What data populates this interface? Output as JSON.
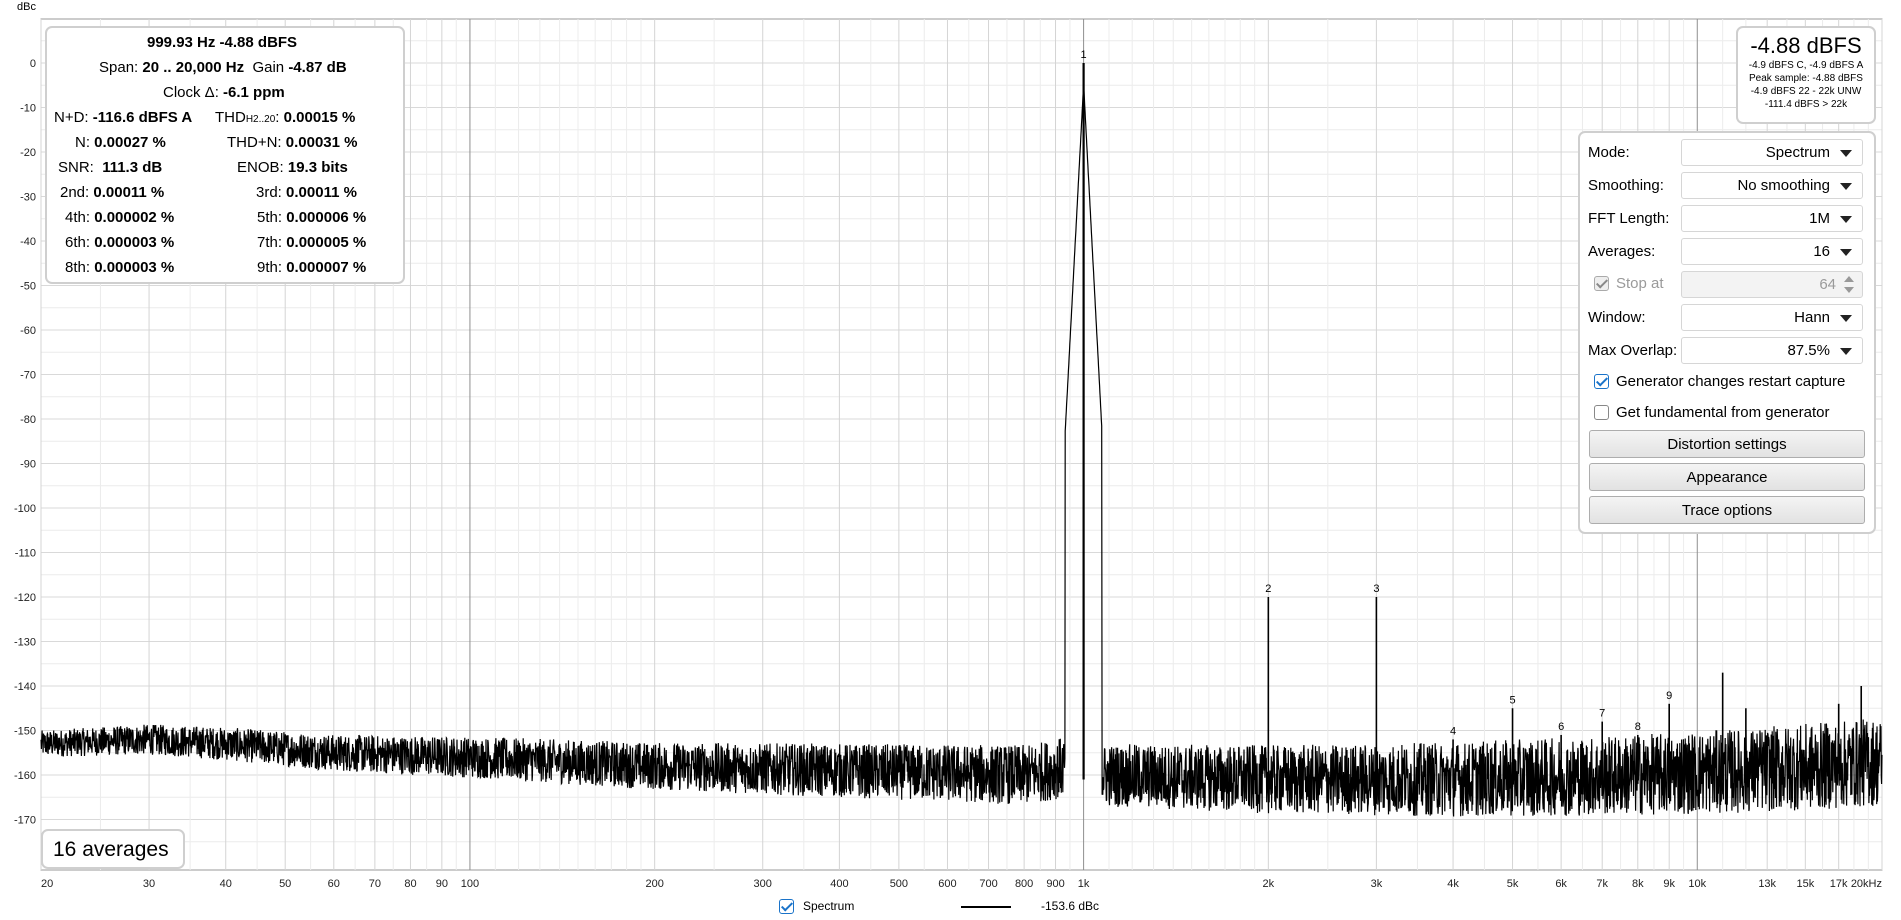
{
  "chart_data": {
    "type": "line",
    "title": "",
    "ylabel": "dBc",
    "xlabel": "",
    "x_scale": "log",
    "xlim": [
      20,
      20000
    ],
    "ylim": [
      -180,
      10
    ],
    "grid": true,
    "yticks": [
      0,
      -10,
      -20,
      -30,
      -40,
      -50,
      -60,
      -70,
      -80,
      -90,
      -100,
      -110,
      -120,
      -130,
      -140,
      -150,
      -160,
      -170
    ],
    "xtick_labels": [
      {
        "x": 20,
        "label": "20"
      },
      {
        "x": 30,
        "label": "30"
      },
      {
        "x": 40,
        "label": "40"
      },
      {
        "x": 50,
        "label": "50"
      },
      {
        "x": 60,
        "label": "60"
      },
      {
        "x": 70,
        "label": "70"
      },
      {
        "x": 80,
        "label": "80"
      },
      {
        "x": 90,
        "label": "90"
      },
      {
        "x": 100,
        "label": "100"
      },
      {
        "x": 200,
        "label": "200"
      },
      {
        "x": 300,
        "label": "300"
      },
      {
        "x": 400,
        "label": "400"
      },
      {
        "x": 500,
        "label": "500"
      },
      {
        "x": 600,
        "label": "600"
      },
      {
        "x": 700,
        "label": "700"
      },
      {
        "x": 800,
        "label": "800"
      },
      {
        "x": 900,
        "label": "900"
      },
      {
        "x": 1000,
        "label": "1k"
      },
      {
        "x": 2000,
        "label": "2k"
      },
      {
        "x": 3000,
        "label": "3k"
      },
      {
        "x": 4000,
        "label": "4k"
      },
      {
        "x": 5000,
        "label": "5k"
      },
      {
        "x": 6000,
        "label": "6k"
      },
      {
        "x": 7000,
        "label": "7k"
      },
      {
        "x": 8000,
        "label": "8k"
      },
      {
        "x": 9000,
        "label": "9k"
      },
      {
        "x": 10000,
        "label": "10k"
      },
      {
        "x": 13000,
        "label": "13k"
      },
      {
        "x": 15000,
        "label": "15k"
      },
      {
        "x": 17000,
        "label": "17k"
      },
      {
        "x": 20000,
        "label": "20kHz"
      }
    ],
    "minor_x_gridlines": [
      25,
      35,
      45,
      55,
      65,
      75,
      85,
      95,
      110,
      120,
      130,
      140,
      150,
      160,
      170,
      180,
      190,
      250,
      350,
      450,
      550,
      650,
      750,
      850,
      950,
      1100,
      1200,
      1300,
      1400,
      1500,
      1600,
      1700,
      1800,
      1900,
      2500,
      3500,
      4500,
      5500,
      6500,
      7500,
      8500,
      9500,
      11000,
      12000,
      14000,
      16000,
      18000,
      19000
    ],
    "major_x_gridlines": [
      100,
      1000,
      10000
    ],
    "noise_floor": [
      [
        20,
        -153
      ],
      [
        30,
        -152
      ],
      [
        40,
        -153
      ],
      [
        60,
        -155
      ],
      [
        100,
        -156
      ],
      [
        200,
        -158
      ],
      [
        400,
        -159
      ],
      [
        800,
        -160
      ],
      [
        950,
        -158
      ],
      [
        1050,
        -160
      ],
      [
        2000,
        -161
      ],
      [
        4000,
        -161
      ],
      [
        8000,
        -160
      ],
      [
        12000,
        -159
      ],
      [
        16000,
        -158
      ],
      [
        20000,
        -157
      ]
    ],
    "peaks": [
      {
        "x": 1000,
        "y": 0,
        "label": "1"
      },
      {
        "x": 2000,
        "y": -120,
        "label": "2"
      },
      {
        "x": 3000,
        "y": -120,
        "label": "3"
      },
      {
        "x": 4000,
        "y": -152,
        "label": "4"
      },
      {
        "x": 5000,
        "y": -145,
        "label": "5"
      },
      {
        "x": 6000,
        "y": -151,
        "label": "6"
      },
      {
        "x": 7000,
        "y": -148,
        "label": "7"
      },
      {
        "x": 8000,
        "y": -151,
        "label": "8"
      },
      {
        "x": 9000,
        "y": -144,
        "label": "9"
      },
      {
        "x": 11000,
        "y": -137,
        "label": ""
      },
      {
        "x": 12000,
        "y": -145,
        "label": ""
      },
      {
        "x": 15000,
        "y": -156,
        "label": ""
      },
      {
        "x": 17000,
        "y": -144,
        "label": ""
      },
      {
        "x": 18500,
        "y": -140,
        "label": ""
      }
    ],
    "series": [
      {
        "name": "Spectrum",
        "value_text": "-153.6 dBc",
        "color": "#000000"
      }
    ],
    "legend_placement": "bottom-center"
  },
  "stats": {
    "line1": "999.93 Hz  -4.88 dBFS",
    "span_label": "Span:",
    "span_value": "20 .. 20,000 Hz",
    "gain_label": "Gain",
    "gain_value": "-4.87 dB",
    "clock_label": "Clock Δ:",
    "clock_value": "-6.1 ppm",
    "nd_label": "N+D:",
    "nd_value": "-116.6 dBFS A",
    "thd_label": "THD",
    "thd_sub": "H2..20",
    "thd_colon": ":",
    "thd_value": "0.00015 %",
    "n_label": "N:",
    "n_value": "0.00027 %",
    "thdn_label": "THD+N:",
    "thdn_value": "0.00031 %",
    "snr_label": "SNR:",
    "snr_value": "111.3 dB",
    "enob_label": "ENOB:",
    "enob_value": "19.3 bits",
    "h2_label": "2nd:",
    "h2_value": "0.00011 %",
    "h3_label": "3rd:",
    "h3_value": "0.00011 %",
    "h4_label": "4th:",
    "h4_value": "0.000002 %",
    "h5_label": "5th:",
    "h5_value": "0.000006 %",
    "h6_label": "6th:",
    "h6_value": "0.000003 %",
    "h7_label": "7th:",
    "h7_value": "0.000005 %",
    "h8_label": "8th:",
    "h8_value": "0.000003 %",
    "h9_label": "9th:",
    "h9_value": "0.000007 %"
  },
  "peak_box": {
    "main": "-4.88 dBFS",
    "line1": "-4.9 dBFS C, -4.9 dBFS A",
    "line2": "Peak sample: -4.88 dBFS",
    "line3": "-4.9 dBFS 22 - 22k UNW",
    "line4": "-111.4 dBFS > 22k"
  },
  "settings": {
    "mode_label": "Mode:",
    "mode_value": "Spectrum",
    "smoothing_label": "Smoothing:",
    "smoothing_value": "No smoothing",
    "fft_label": "FFT Length:",
    "fft_value": "1M",
    "averages_label": "Averages:",
    "averages_value": "16",
    "stop_at_label": "Stop at",
    "stop_at_value": "64",
    "window_label": "Window:",
    "window_value": "Hann",
    "overlap_label": "Max Overlap:",
    "overlap_value": "87.5%",
    "gen_restart_label": "Generator changes restart capture",
    "get_fund_label": "Get fundamental from generator",
    "distortion_btn": "Distortion settings",
    "appearance_btn": "Appearance",
    "trace_btn": "Trace options"
  },
  "averages_badge": "16 averages"
}
